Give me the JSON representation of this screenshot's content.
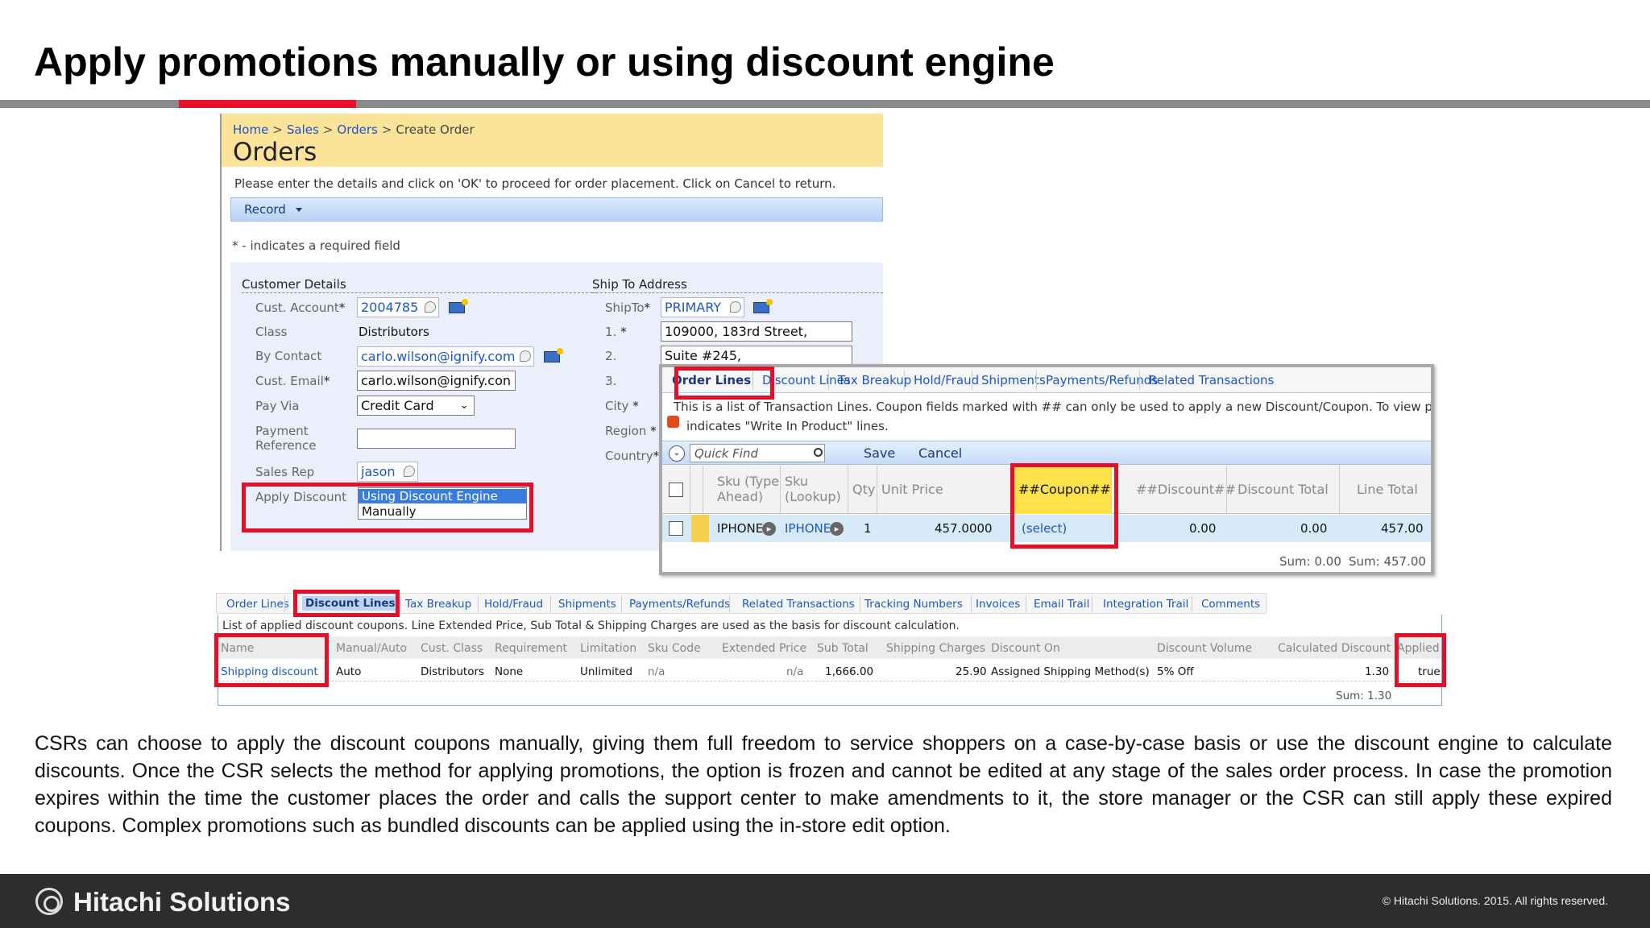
{
  "slide": {
    "title": "Apply promotions manually or using discount engine",
    "body": "CSRs can choose to apply the discount coupons manually, giving them full freedom to service shoppers on a case-by-case basis or use the discount engine to calculate discounts. Once the CSR selects the method for applying promotions, the option is frozen and cannot be edited at any stage of the sales order process. In case the promotion expires within the time the customer places the order and calls the support center to make amendments to it, the store manager or the CSR can still apply these expired coupons. Complex promotions such as bundled discounts can be applied using the in-store edit option.",
    "footer_logo": "Hitachi Solutions",
    "copyright": "© Hitachi Solutions. 2015. All rights reserved.",
    "colors": {
      "accent_red": "#e8102a",
      "footer_bg": "#2d2d2d",
      "header_yellow": "#fbe39a",
      "link_blue": "#1a56c9"
    }
  },
  "orders": {
    "breadcrumb": [
      "Home",
      "Sales",
      "Orders",
      "Create Order"
    ],
    "breadcrumb_sep": ">",
    "title": "Orders",
    "instructions": "Please enter the details and click on 'OK' to proceed for order placement. Click on Cancel to return.",
    "record_menu": "Record",
    "required_note": "* - indicates a required field",
    "customer_section": "Customer Details",
    "ship_section": "Ship To Address",
    "fields": {
      "cust_account_label": "Cust. Account",
      "cust_account_value": "2004785",
      "class_label": "Class",
      "class_value": "Distributors",
      "by_contact_label": "By Contact",
      "by_contact_value": "carlo.wilson@ignify.com",
      "cust_email_label": "Cust. Email",
      "cust_email_value": "carlo.wilson@ignify.con",
      "pay_via_label": "Pay Via",
      "pay_via_value": "Credit Card",
      "payment_ref_label_1": "Payment",
      "payment_ref_label_2": "Reference",
      "payment_ref_value": "",
      "sales_rep_label": "Sales Rep",
      "sales_rep_value": "jason",
      "apply_discount_label": "Apply Discount",
      "apply_discount_options": [
        "Using Discount Engine",
        "Manually"
      ]
    },
    "ship": {
      "shipto_label": "ShipTo",
      "shipto_value": "PRIMARY",
      "line1_label": "1.",
      "line1_value": "109000, 183rd Street,",
      "line2_label": "2.",
      "line2_value": "Suite #245,",
      "line3_label": "3.",
      "city_label": "City",
      "region_label": "Region",
      "country_label": "Country"
    },
    "required_mark": "*"
  },
  "order_lines": {
    "tabs": [
      "Order Lines",
      "Discount Lines",
      "Tax Breakup",
      "Hold/Fraud",
      "Shipments",
      "Payments/Refunds",
      "Related Transactions"
    ],
    "desc_1": "This is a list of Transaction Lines. Coupon fields marked with ## can only be used to apply a new Discount/Coupon. To view p",
    "desc_2": "indicates \"Write In Product\" lines.",
    "quick_find_placeholder": "Quick Find",
    "save": "Save",
    "cancel": "Cancel",
    "columns": [
      "Sku (Type",
      "Ahead)",
      "Sku",
      "(Lookup)",
      "Qty",
      "Unit Price",
      "##Coupon##",
      "##Discount##",
      "Discount Total",
      "Line Total"
    ],
    "row": {
      "sku_type_ahead": "IPHONE",
      "sku_lookup": "IPHONE",
      "qty": "1",
      "unit_price": "457.0000",
      "coupon": "(select)",
      "discount": "0.00",
      "discount_total": "0.00",
      "line_total": "457.00"
    },
    "sum_discount": "Sum: 0.00",
    "sum_line": "Sum: 457.00"
  },
  "discount_lines": {
    "tabs": [
      "Order Lines",
      "Discount Lines",
      "Tax Breakup",
      "Hold/Fraud",
      "Shipments",
      "Payments/Refunds",
      "Related Transactions",
      "Tracking Numbers",
      "Invoices",
      "Email Trail",
      "Integration Trail",
      "Comments"
    ],
    "desc": "List of applied discount coupons. Line Extended Price, Sub Total & Shipping Charges are used as the basis for discount calculation.",
    "columns": [
      "Name",
      "Manual/Auto",
      "Cust. Class",
      "Requirement",
      "Limitation",
      "Sku Code",
      "Extended Price",
      "Sub Total",
      "Shipping Charges",
      "Discount On",
      "Discount Volume",
      "Calculated Discount",
      "Applied"
    ],
    "row": [
      "Shipping discount",
      "Auto",
      "Distributors",
      "None",
      "Unlimited",
      "n/a",
      "n/a",
      "1,666.00",
      "25.90",
      "Assigned Shipping Method(s)",
      "5% Off",
      "1.30",
      "true"
    ],
    "sum": "Sum: 1.30"
  }
}
